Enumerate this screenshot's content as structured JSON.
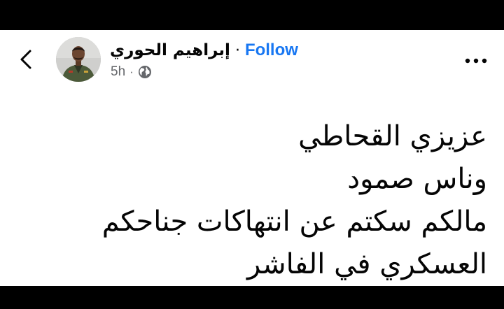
{
  "post": {
    "author": {
      "name": "إبراهيم الحوري",
      "avatar_icon": "profile-photo"
    },
    "separator": "·",
    "follow_label": "Follow",
    "timestamp": "5h",
    "meta_separator": "·",
    "audience_icon": "globe-icon",
    "back_icon": "chevron-left-icon",
    "more_icon": "ellipsis-icon",
    "body_lines": [
      "عزيزي القحاطي",
      "وناس صمود",
      "مالكم سكتم عن انتهاكات جناحكم",
      "العسكري في الفاشر"
    ]
  },
  "colors": {
    "accent": "#1877f2",
    "text_primary": "#050505",
    "text_secondary": "#65676b",
    "background": "#ffffff",
    "letterbox": "#000000"
  }
}
